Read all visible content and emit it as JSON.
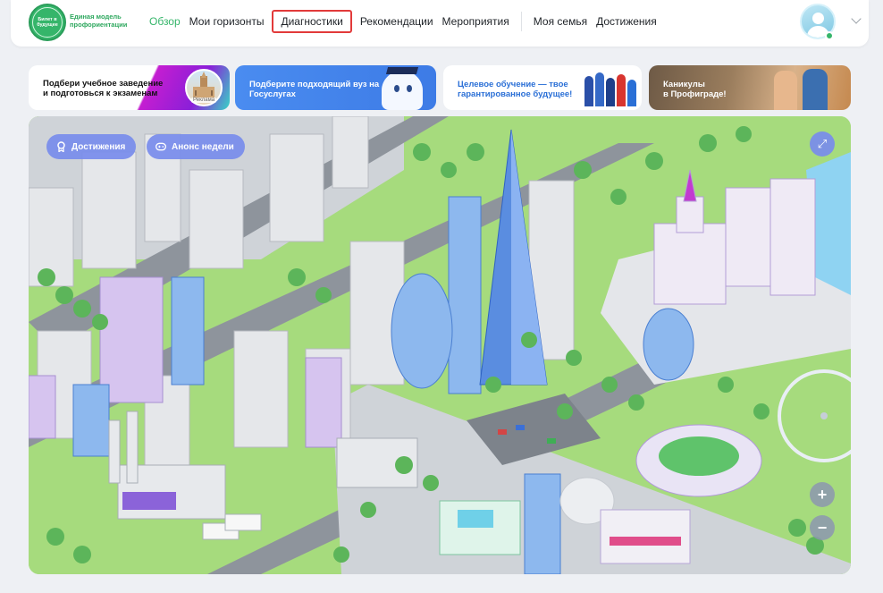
{
  "header": {
    "logo_text": "Билет в будущее",
    "logo_caption": "Единая модель профориентации",
    "nav": [
      {
        "label": "Обзор",
        "active": true
      },
      {
        "label": "Мои горизонты"
      },
      {
        "label": "Диагностики",
        "highlighted": true
      },
      {
        "label": "Рекомендации"
      },
      {
        "label": "Мероприятия"
      },
      {
        "label": "Моя семья"
      },
      {
        "label": "Достижения"
      }
    ],
    "accent_color": "#35b56a",
    "highlight_color": "#e23a3a"
  },
  "banners": [
    {
      "text_line1": "Подбери учебное заведение",
      "text_line2": "и подготовься к экзаменам",
      "tag": "Реклама"
    },
    {
      "text_line1": "Подберите подходящий вуз на",
      "text_line2": "Госуслугах"
    },
    {
      "text_line1": "Целевое обучение — твое",
      "text_line2": "гарантированное будущее!"
    },
    {
      "text_line1": "Каникулы",
      "text_line2": "в Профиграде!"
    }
  ],
  "map": {
    "achievements_label": "Достижения",
    "week_announce_label": "Анонс недели",
    "zoom_in": "+",
    "zoom_out": "−",
    "expand_icon": "⤢"
  }
}
